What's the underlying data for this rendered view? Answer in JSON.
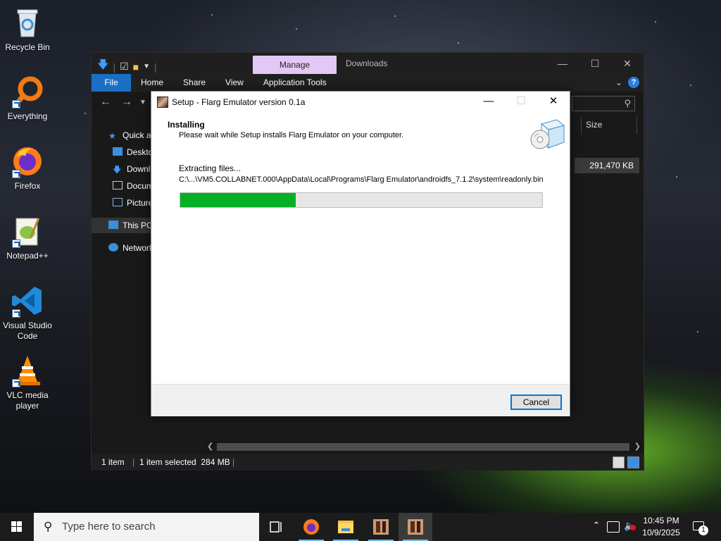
{
  "desktop": {
    "icons": [
      {
        "label": "Recycle Bin",
        "icon": "recycle-bin-icon"
      },
      {
        "label": "Everything",
        "icon": "everything-search-icon"
      },
      {
        "label": "Firefox",
        "icon": "firefox-icon"
      },
      {
        "label": "Notepad++",
        "icon": "notepad-plus-plus-icon"
      },
      {
        "label": "Visual Studio Code",
        "icon": "vscode-icon"
      },
      {
        "label": "VLC media player",
        "icon": "vlc-icon"
      }
    ]
  },
  "explorer": {
    "manage_tab": "Manage",
    "title": "Downloads",
    "ribbon_tabs": [
      "File",
      "Home",
      "Share",
      "View",
      "Application Tools"
    ],
    "nav_items": [
      "Quick access",
      "Desktop",
      "Downloads",
      "Documents",
      "Pictures",
      "This PC",
      "Network"
    ],
    "column_header": "Size",
    "file_size": "291,470 KB",
    "status": {
      "items": "1 item",
      "selected": "1 item selected  284 MB"
    }
  },
  "setup": {
    "title": "Setup - Flarg Emulator version 0.1a",
    "heading": "Installing",
    "subheading": "Please wait while Setup installs Flarg Emulator on your computer.",
    "status": "Extracting files...",
    "path": "C:\\...\\VM5.COLLABNET.000\\AppData\\Local\\Programs\\Flarg Emulator\\androidfs_7.1.2\\system\\readonly.bin",
    "progress": 0.32,
    "cancel_label": "Cancel",
    "colors": {
      "progress": "#06b025",
      "focus": "#0078d7"
    }
  },
  "taskbar": {
    "search_placeholder": "Type here to search",
    "time": "10:45 PM",
    "date": "10/9/2025",
    "notification_count": "1"
  }
}
